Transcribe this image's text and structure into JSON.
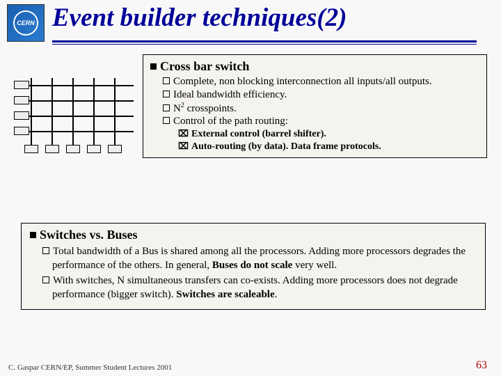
{
  "logo": {
    "text": "CERN"
  },
  "title": "Event builder techniques(2)",
  "section1": {
    "heading": "Cross bar switch",
    "points": [
      "Complete, non blocking interconnection all inputs/all outputs.",
      "Ideal bandwidth efficiency.",
      "N² crosspoints.",
      "Control of the path routing:"
    ],
    "subpoints": [
      "External control (barrel shifter).",
      "Auto-routing (by data). Data frame protocols."
    ]
  },
  "section2": {
    "heading": "Switches vs. Buses",
    "points": [
      {
        "pre": "Total bandwidth of a Bus is shared among all the processors. Adding more processors degrades the performance of the others. In general, ",
        "bold": "Buses do not scale",
        "post": " very well."
      },
      {
        "pre": "With switches, N simultaneous transfers can co-exists. Adding more processors does not degrade performance (bigger switch). ",
        "bold": "Switches are scaleable",
        "post": "."
      }
    ]
  },
  "footer": "C. Gaspar CERN/EP, Summer Student Lectures 2001",
  "page": "63"
}
